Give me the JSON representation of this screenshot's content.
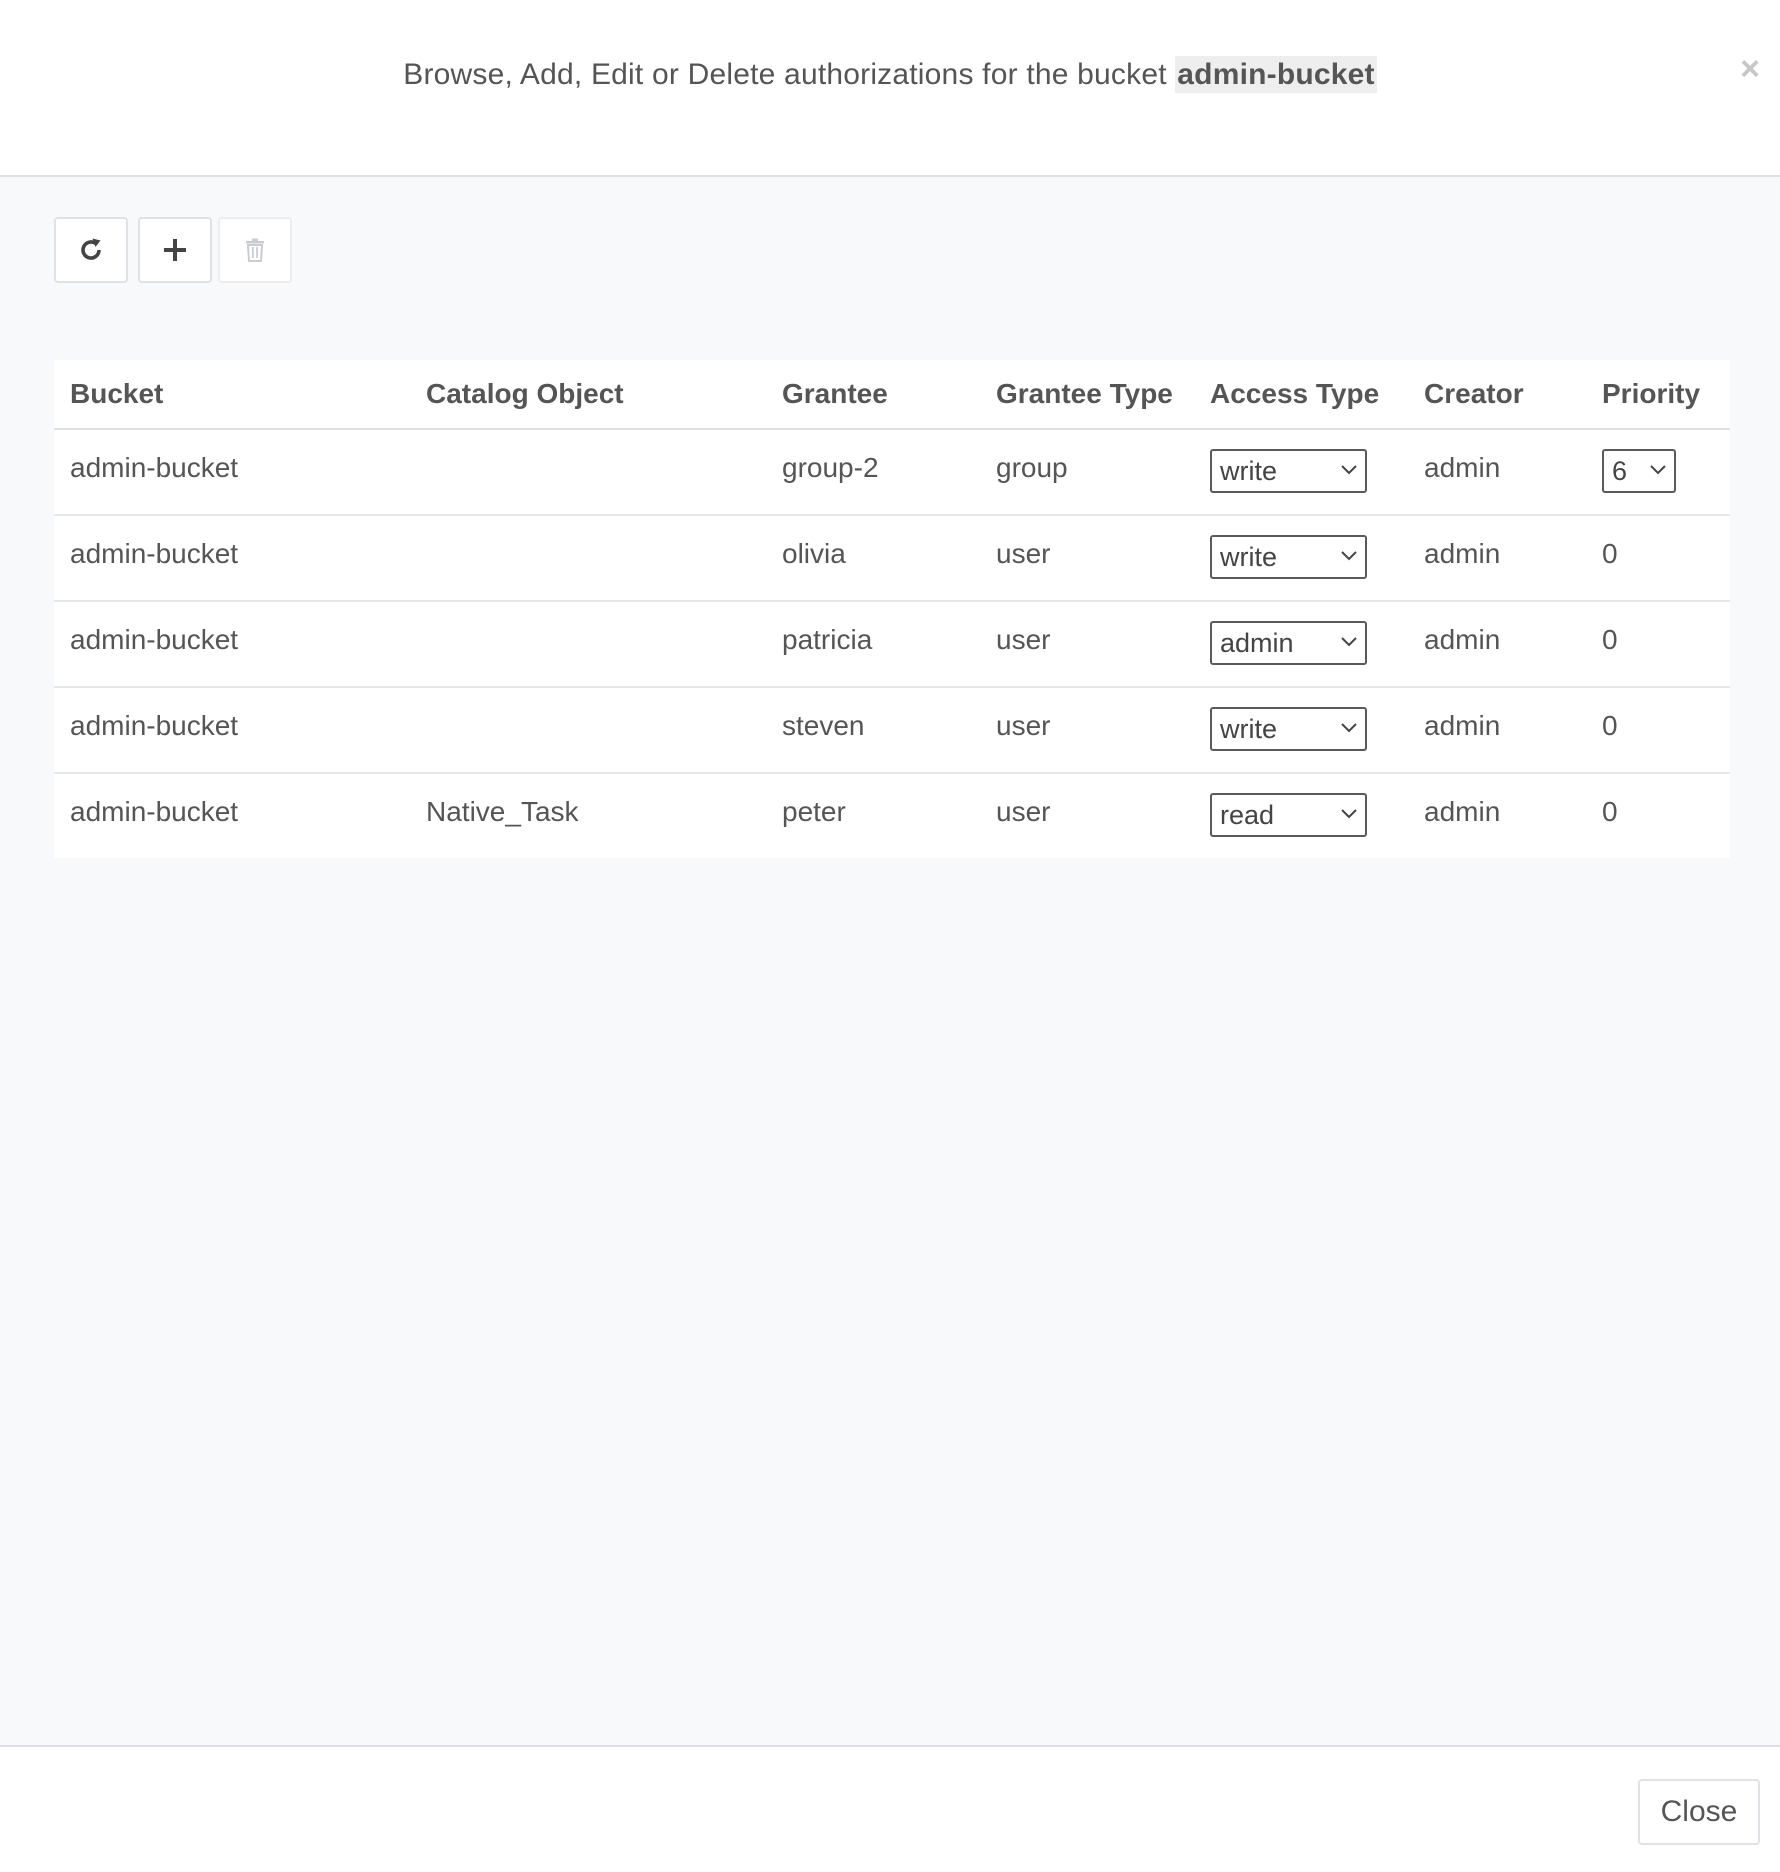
{
  "modal": {
    "title_prefix": "Browse, Add, Edit or Delete authorizations for the bucket",
    "bucket_name": "admin-bucket",
    "close_x": "×",
    "close_button": "Close"
  },
  "toolbar": {
    "buttons": [
      {
        "name": "refresh",
        "icon": "refresh-icon"
      },
      {
        "name": "add",
        "icon": "plus-icon"
      },
      {
        "name": "delete",
        "icon": "trash-icon",
        "disabled": true
      }
    ]
  },
  "table": {
    "columns": [
      "Bucket",
      "Catalog Object",
      "Grantee",
      "Grantee Type",
      "Access Type",
      "Creator",
      "Priority"
    ],
    "rows": [
      {
        "bucket": "admin-bucket",
        "catalog_object": "",
        "grantee": "group-2",
        "grantee_type": "group",
        "access_type": "write",
        "creator": "admin",
        "priority": "6"
      },
      {
        "bucket": "admin-bucket",
        "catalog_object": "",
        "grantee": "olivia",
        "grantee_type": "user",
        "access_type": "write",
        "creator": "admin",
        "priority": "0"
      },
      {
        "bucket": "admin-bucket",
        "catalog_object": "",
        "grantee": "patricia",
        "grantee_type": "user",
        "access_type": "admin",
        "creator": "admin",
        "priority": "0"
      },
      {
        "bucket": "admin-bucket",
        "catalog_object": "",
        "grantee": "steven",
        "grantee_type": "user",
        "access_type": "write",
        "creator": "admin",
        "priority": "0"
      },
      {
        "bucket": "admin-bucket",
        "catalog_object": "Native_Task",
        "grantee": "peter",
        "grantee_type": "user",
        "access_type": "read",
        "creator": "admin",
        "priority": "0"
      }
    ]
  },
  "colors": {
    "body_bg": "#f8f9fb",
    "text": "#555555",
    "border": "#dde1e6"
  }
}
